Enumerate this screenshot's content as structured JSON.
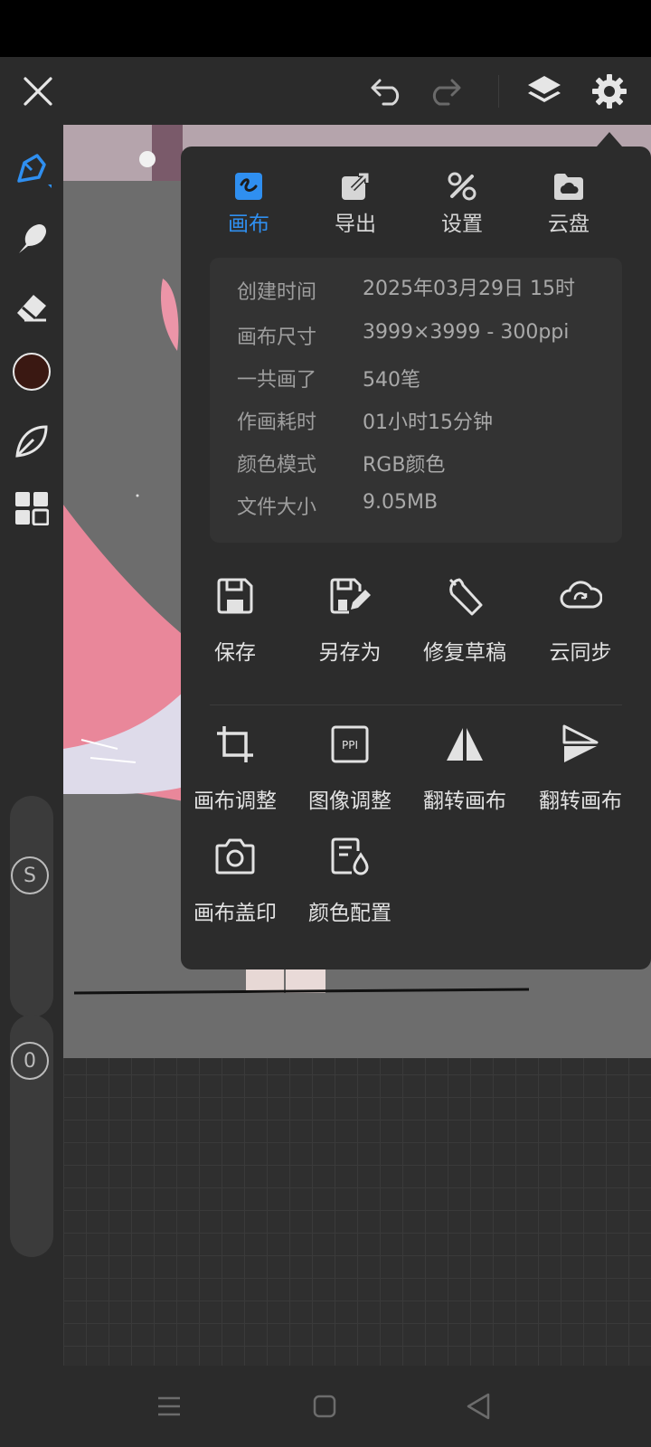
{
  "colors": {
    "accent": "#2f8ff0",
    "current_color": "#3a1812",
    "panel_bg": "#2c2c2c"
  },
  "top_bar": {
    "close_icon": "close-icon",
    "undo_icon": "undo-icon",
    "redo_icon": "redo-icon",
    "layers_icon": "layers-icon",
    "settings_icon": "gear-icon"
  },
  "tools": [
    "brush-icon",
    "smudge-icon",
    "eraser-icon",
    "color-swatch",
    "leaf-icon",
    "grid-icon"
  ],
  "sliders": {
    "size_label": "S",
    "opacity_label": "0"
  },
  "menu": {
    "tabs": [
      {
        "label": "画布",
        "icon": "canvas-icon",
        "active": true
      },
      {
        "label": "导出",
        "icon": "export-icon",
        "active": false
      },
      {
        "label": "设置",
        "icon": "settings-tools-icon",
        "active": false
      },
      {
        "label": "云盘",
        "icon": "cloud-drive-icon",
        "active": false
      }
    ],
    "info": [
      {
        "key": "创建时间",
        "value": "2025年03月29日 15时"
      },
      {
        "key": "画布尺寸",
        "value": "3999×3999 - 300ppi"
      },
      {
        "key": "一共画了",
        "value": "540笔"
      },
      {
        "key": "作画耗时",
        "value": "01小时15分钟"
      },
      {
        "key": "颜色模式",
        "value": "RGB颜色"
      },
      {
        "key": "文件大小",
        "value": "9.05MB"
      }
    ],
    "actions_row1": [
      {
        "label": "保存",
        "icon": "save-icon"
      },
      {
        "label": "另存为",
        "icon": "save-as-icon"
      },
      {
        "label": "修复草稿",
        "icon": "wrench-icon"
      },
      {
        "label": "云同步",
        "icon": "cloud-sync-icon"
      }
    ],
    "actions_row2": [
      {
        "label": "画布调整",
        "icon": "crop-icon"
      },
      {
        "label": "图像调整",
        "icon": "ppi-icon",
        "icon_text": "PPI"
      },
      {
        "label": "翻转画布",
        "icon": "flip-horizontal-icon"
      },
      {
        "label": "翻转画布",
        "icon": "flip-vertical-icon"
      }
    ],
    "actions_row3": [
      {
        "label": "画布盖印",
        "icon": "camera-icon"
      },
      {
        "label": "颜色配置",
        "icon": "color-config-icon"
      }
    ]
  },
  "nav": [
    "menu-icon",
    "home-icon",
    "back-icon"
  ]
}
